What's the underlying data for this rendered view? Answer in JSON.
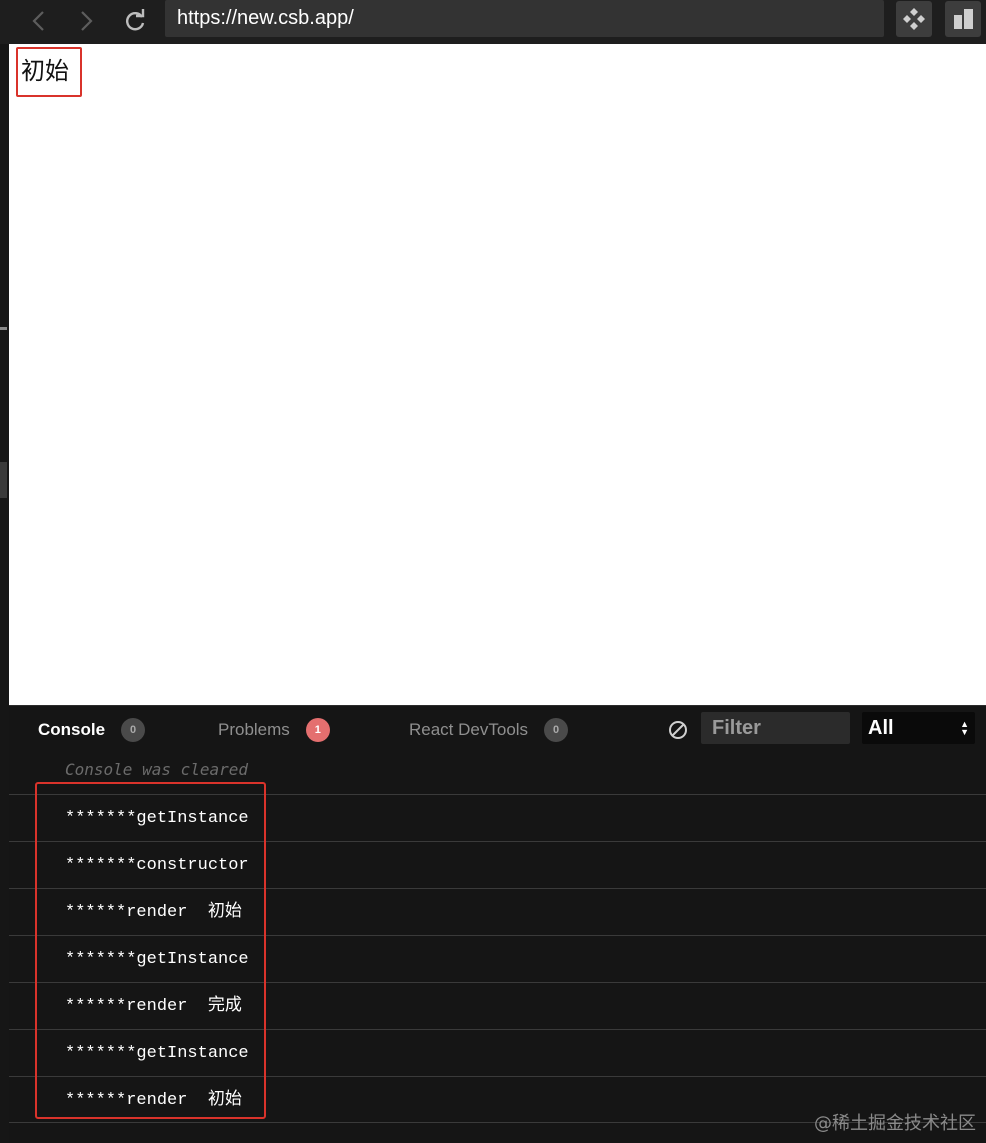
{
  "browser": {
    "url": "https://new.csb.app/",
    "back_icon": "chevron-left-icon",
    "forward_icon": "chevron-right-icon",
    "reload_icon": "reload-icon",
    "extension_icon": "move-arrows-icon",
    "split_icon": "split-view-icon"
  },
  "preview": {
    "text": "初始"
  },
  "devtools": {
    "tabs": [
      {
        "label": "Console",
        "count": "0",
        "active": true
      },
      {
        "label": "Problems",
        "count": "1",
        "active": false
      },
      {
        "label": "React DevTools",
        "count": "0",
        "active": false
      }
    ],
    "filter_placeholder": "Filter",
    "level": "All",
    "cleared_message": "Console was cleared",
    "logs": [
      "*******getInstance",
      "*******constructor",
      "******render  初始",
      "*******getInstance",
      "******render  完成",
      "*******getInstance",
      "******render  初始"
    ]
  },
  "watermark": "@稀土掘金技术社区",
  "colors": {
    "highlight": "#d9332b",
    "error_badge": "#e46f6f",
    "devtools_bg": "#151515"
  }
}
